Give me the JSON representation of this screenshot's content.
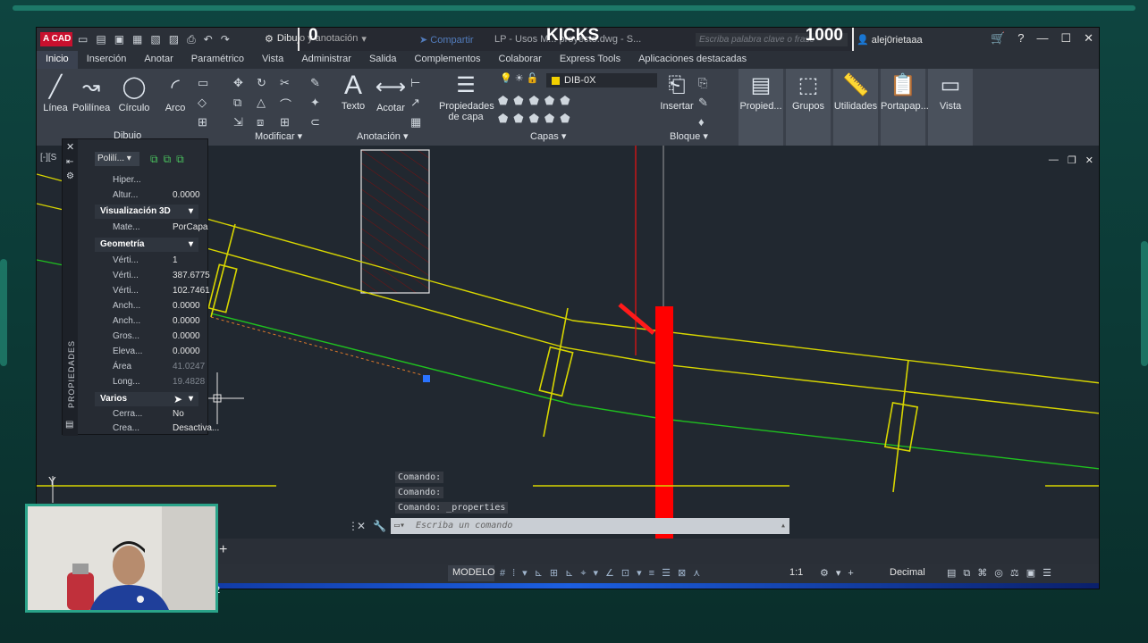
{
  "app": {
    "logo": "A CAD",
    "workspace": "Dibujo y anotación",
    "share": "Compartir",
    "document_title": "LP - Usos M... proyecto.dwg - S...",
    "search_placeholder": "Escriba palabra clave o frase",
    "user": "alej0rietaaa"
  },
  "overlay": {
    "left_count": "0",
    "title": "KICKS",
    "right_count": "1000"
  },
  "tabs": [
    "Inicio",
    "Inserción",
    "Anotar",
    "Paramétrico",
    "Vista",
    "Administrar",
    "Salida",
    "Complementos",
    "Colaborar",
    "Express Tools",
    "Aplicaciones destacadas"
  ],
  "ribbon": {
    "draw": {
      "linea": "Línea",
      "polilinea": "Polilínea",
      "circulo": "Círculo",
      "arco": "Arco",
      "panel": "Dibujo"
    },
    "modify": {
      "panel": "Modificar"
    },
    "annotation": {
      "texto": "Texto",
      "acotar": "Acotar",
      "panel": "Anotación"
    },
    "layers": {
      "props": "Propiedades de capa",
      "current": "DIB-0X",
      "panel": "Capas"
    },
    "block": {
      "insertar": "Insertar",
      "panel": "Bloque"
    },
    "right": [
      "Propied...",
      "Grupos",
      "Utilidades",
      "Portapap...",
      "Vista"
    ]
  },
  "viewport_label": "[-][S",
  "properties": {
    "side_label": "PROPIEDADES",
    "selection": "Polilí...",
    "rows_top": [
      {
        "k": "Hiper...",
        "v": ""
      },
      {
        "k": "Altur...",
        "v": "0.0000"
      }
    ],
    "sections": {
      "vis3d": "Visualización 3D",
      "geometry": "Geometría",
      "misc": "Varios"
    },
    "mat": {
      "k": "Mate...",
      "v": "PorCapa"
    },
    "geometry": [
      {
        "k": "Vérti...",
        "v": "1"
      },
      {
        "k": "Vérti...",
        "v": "387.6775"
      },
      {
        "k": "Vérti...",
        "v": "102.7461"
      },
      {
        "k": "Anch...",
        "v": "0.0000"
      },
      {
        "k": "Anch...",
        "v": "0.0000"
      },
      {
        "k": "Gros...",
        "v": "0.0000"
      },
      {
        "k": "Eleva...",
        "v": "0.0000"
      },
      {
        "k": "Área",
        "v": "41.0247"
      },
      {
        "k": "Long...",
        "v": "19.4828"
      }
    ],
    "misc": [
      {
        "k": "Cerra...",
        "v": "No"
      },
      {
        "k": "Crea...",
        "v": "Desactiva..."
      }
    ]
  },
  "command": {
    "history": [
      "Comando:",
      "Comando:",
      "Comando: _properties"
    ],
    "placeholder": "Escriba un comando"
  },
  "status": {
    "model": "MODELO",
    "scale": "1:1",
    "units": "Decimal"
  },
  "taskbar_num": "2",
  "axis_label": "Y",
  "colors": {
    "red": "#ff0000",
    "yellow": "#d8d600",
    "green": "#1fc11f",
    "accent": "#2aa389"
  }
}
